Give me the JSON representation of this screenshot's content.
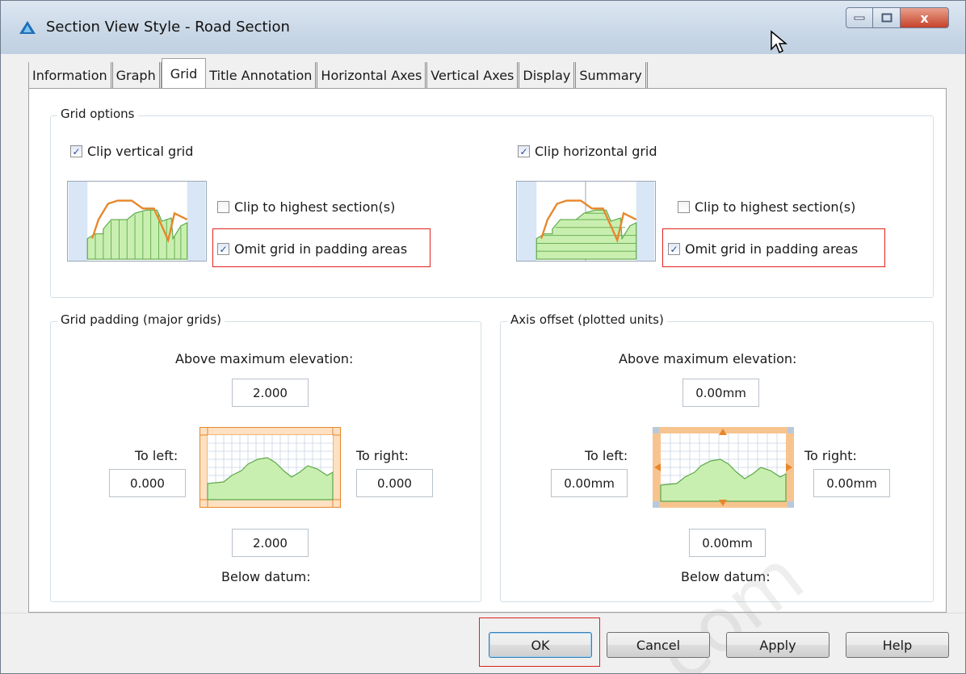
{
  "window": {
    "title": "Section View Style - Road Section",
    "close_glyph": "x",
    "icons": [
      "app-icon",
      "minimize-icon",
      "maximize-icon",
      "close-icon",
      "cursor-icon"
    ]
  },
  "tabs": [
    {
      "label": "Information",
      "active": false
    },
    {
      "label": "Graph",
      "active": false
    },
    {
      "label": "Grid",
      "active": true
    },
    {
      "label": "Title Annotation",
      "active": false
    },
    {
      "label": "Horizontal Axes",
      "active": false
    },
    {
      "label": "Vertical Axes",
      "active": false
    },
    {
      "label": "Display",
      "active": false
    },
    {
      "label": "Summary",
      "active": false
    }
  ],
  "grid_options": {
    "label": "Grid options",
    "vertical": {
      "clip_label": "Clip vertical grid",
      "clip_checked": true,
      "highest_label": "Clip to highest section(s)",
      "highest_checked": false,
      "omit_label": "Omit grid in padding areas",
      "omit_checked": true
    },
    "horizontal": {
      "clip_label": "Clip horizontal grid",
      "clip_checked": true,
      "highest_label": "Clip to highest section(s)",
      "highest_checked": false,
      "omit_label": "Omit grid in padding areas",
      "omit_checked": true
    }
  },
  "grid_padding": {
    "label": "Grid padding (major grids)",
    "above_label": "Above maximum elevation:",
    "above_value": "2.000",
    "left_label": "To left:",
    "left_value": "0.000",
    "right_label": "To right:",
    "right_value": "0.000",
    "below_value": "2.000",
    "below_label": "Below datum:"
  },
  "axis_offset": {
    "label": "Axis offset (plotted units)",
    "above_label": "Above maximum elevation:",
    "above_value": "0.00mm",
    "left_label": "To left:",
    "left_value": "0.00mm",
    "right_label": "To right:",
    "right_value": "0.00mm",
    "below_value": "0.00mm",
    "below_label": "Below datum:"
  },
  "buttons": {
    "ok": "OK",
    "cancel": "Cancel",
    "apply": "Apply",
    "help": "Help"
  },
  "watermark": "com",
  "colors": {
    "accent_orange": "#e8862a",
    "fill_green": "#c9efb0",
    "highlight_red": "#e0201b"
  }
}
